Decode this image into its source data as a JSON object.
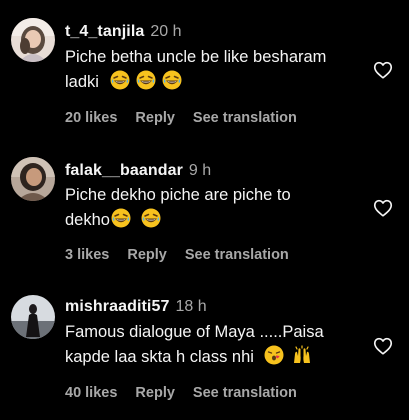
{
  "colors": {
    "background": "#000000",
    "primary_text": "#f5f5f5",
    "secondary_text": "#a8a8a8"
  },
  "comments": [
    {
      "username": "t_4_tanjila",
      "time": "20 h",
      "text_line1": "Piche betha uncle be like besharam",
      "text_line2": "ladki",
      "emojis": [
        "laughing-emoji",
        "laughing-emoji",
        "laughing-emoji"
      ],
      "likes": "20 likes",
      "reply": "Reply",
      "see_translation": "See translation",
      "like_icon": "heart-outline-icon"
    },
    {
      "username": "falak__baandar",
      "time": "9 h",
      "text_line1": "Piche dekho piche are piche to",
      "text_line2": "dekho",
      "emojis": [
        "laughing-emoji",
        "laughing-emoji"
      ],
      "likes": "3 likes",
      "reply": "Reply",
      "see_translation": "See translation",
      "like_icon": "heart-outline-icon"
    },
    {
      "username": "mishraaditi57",
      "time": "18 h",
      "text_line1": "Famous dialogue of Maya .....Paisa",
      "text_line2": "kapde laa skta h class nhi",
      "emojis": [
        "blowing-kiss-emoji",
        "raising-hands-emoji"
      ],
      "likes": "40 likes",
      "reply": "Reply",
      "see_translation": "See translation",
      "like_icon": "heart-outline-icon"
    }
  ]
}
